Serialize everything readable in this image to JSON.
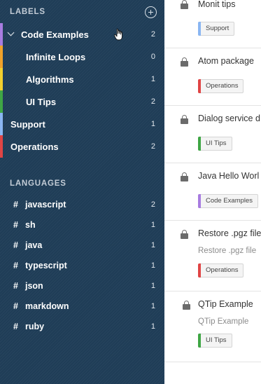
{
  "sidebar": {
    "labels_heading": "LABELS",
    "languages_heading": "LANGUAGES",
    "labels": [
      {
        "name": "Code Examples",
        "count": "2",
        "color": "#a87ce0",
        "expanded": true
      },
      {
        "name": "Infinite Loops",
        "count": "0",
        "color": "#f0a22a"
      },
      {
        "name": "Algorithms",
        "count": "1",
        "color": "#f2cf2e"
      },
      {
        "name": "UI Tips",
        "count": "2",
        "color": "#3fa645"
      },
      {
        "name": "Support",
        "count": "1",
        "color": "#8ab6f2"
      },
      {
        "name": "Operations",
        "count": "2",
        "color": "#e04545"
      }
    ],
    "languages": [
      {
        "hash": "#",
        "name": "javascript",
        "count": "2"
      },
      {
        "hash": "#",
        "name": "sh",
        "count": "1"
      },
      {
        "hash": "#",
        "name": "java",
        "count": "1"
      },
      {
        "hash": "#",
        "name": "typescript",
        "count": "1"
      },
      {
        "hash": "#",
        "name": "json",
        "count": "1"
      },
      {
        "hash": "#",
        "name": "markdown",
        "count": "1"
      },
      {
        "hash": "#",
        "name": "ruby",
        "count": "1"
      }
    ]
  },
  "notes": [
    {
      "title": "Monit tips",
      "subtitle": "",
      "tag": "Support",
      "tag_color": "#8ab6f2"
    },
    {
      "title": "Atom package",
      "subtitle": "",
      "tag": "Operations",
      "tag_color": "#e04545"
    },
    {
      "title": "Dialog service d",
      "subtitle": "",
      "tag": "UI Tips",
      "tag_color": "#3fa645"
    },
    {
      "title": "Java Hello Worl",
      "subtitle": "",
      "tag": "Code Examples",
      "tag_color": "#a87ce0"
    },
    {
      "title": "Restore .pgz file",
      "subtitle": "Restore .pgz file",
      "tag": "Operations",
      "tag_color": "#e04545"
    },
    {
      "title": "QTip Example",
      "subtitle": "QTip Example",
      "tag": "UI Tips",
      "tag_color": "#3fa645"
    }
  ],
  "colors": {
    "sidebar_bg": "#1f3d57",
    "lock_icon": "#6b6b6b"
  },
  "icons": {
    "add_label": "plus-circle-icon",
    "expand": "chevron-down-icon",
    "lock": "lock-icon",
    "cursor": "hand-grab-cursor-icon"
  }
}
